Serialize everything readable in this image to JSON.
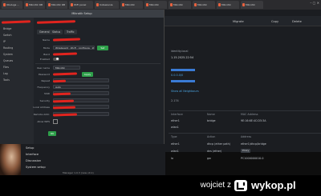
{
  "browser": {
    "tabs": [
      {
        "label": "Obsługa ..."
      },
      {
        "label": "Mikrotik RB"
      },
      {
        "label": "Mikrotik RB"
      },
      {
        "label": "WiFi panel"
      },
      {
        "label": "Ustawienia"
      },
      {
        "label": "Mikrotik"
      },
      {
        "label": "Mikrotik"
      },
      {
        "label": "Mikrotik"
      },
      {
        "label": "Mikrotik"
      },
      {
        "label": "Mikrotik"
      },
      {
        "label": "Mikrotik"
      }
    ],
    "window_controls": "– ▢ ✕"
  },
  "dialog": {
    "title": "Mikrotik Setup",
    "sidebar": [
      "Interfaces",
      "Bridge",
      "Switch",
      "IP",
      "Routing",
      "System",
      "Queues",
      "Files",
      "Log",
      "Tools"
    ],
    "tabs": [
      "General",
      "Status",
      "Traffic"
    ],
    "rows": [
      {
        "label": "Name",
        "value": ""
      },
      {
        "label": "Mode",
        "value": "WireGuard · Wi-Fi · configure · Wireless setup"
      },
      {
        "label": "Band",
        "value": "2.4 / 5 GHz"
      },
      {
        "label": "Enabled",
        "value": ""
      },
      {
        "label": "User name",
        "value": "Mikrotik"
      },
      {
        "label": "Password",
        "value": ""
      },
      {
        "label": "Repeat",
        "value": ""
      },
      {
        "label": "Frequency",
        "value": "Auto"
      },
      {
        "label": "SSID",
        "value": ""
      },
      {
        "label": "Security",
        "value": ""
      },
      {
        "label": "Local Address",
        "value": ""
      },
      {
        "label": "Remote Addr.",
        "value": ""
      },
      {
        "label": "Allow WPS",
        "value": ""
      }
    ],
    "apply_label": "Apply",
    "ok_label": "OK",
    "set_label": "Set"
  },
  "right_panel": {
    "buttons": [
      "Migrate",
      "Copy",
      "Delete"
    ],
    "info_lines": [
      "identity.local",
      "1.15.2025.22:54",
      "",
      ""
    ],
    "link1": "0.0.0.0/0",
    "link2": "Show all Neighbours",
    "value_small": "2.174",
    "table_headers": [
      "Interface",
      "Name",
      "MAC Address"
    ],
    "table_rows": [
      {
        "iface": "ether1",
        "name": "bridge",
        "mac": "9E:16:6E:4C:D5:3A"
      },
      {
        "iface": "wlan1",
        "name": "",
        "mac": ""
      }
    ],
    "table2_headers": [
      "Type",
      "Action",
      "Address"
    ],
    "table2_rows": [
      {
        "type": "ether1",
        "action": "dhcp (ether path)",
        "address": "ether1/dhcp/bridge"
      },
      {
        "type": "wlan1",
        "action": "dns (ether)",
        "address": "Proxy"
      },
      {
        "type": "lo",
        "action": "gw",
        "address": "PC1000000010.0"
      }
    ]
  },
  "bottom_list": [
    "Setup",
    "Interface",
    "Discussion",
    "System setup"
  ],
  "status_bar": "Manager 1.0.3 (new v0.1)",
  "watermark": {
    "user": "wojciet",
    "separator": "z",
    "brand": "wykop.pl"
  }
}
